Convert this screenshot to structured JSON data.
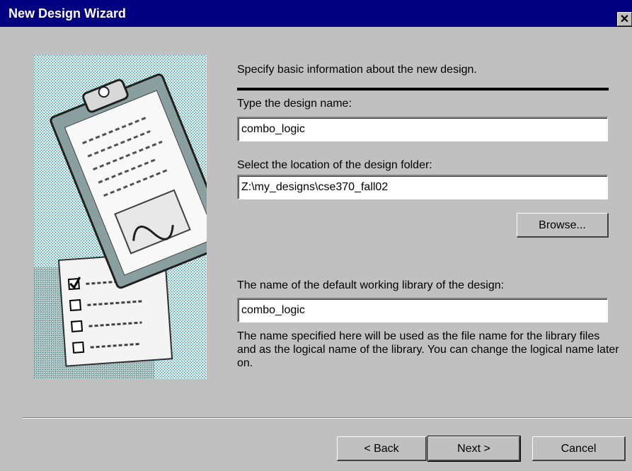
{
  "window": {
    "title": "New Design Wizard",
    "close_glyph": "✕"
  },
  "intro_text": "Specify basic information about the new design.",
  "design_name": {
    "label": "Type the design name:",
    "value": "combo_logic"
  },
  "design_folder": {
    "label": "Select the location of the design folder:",
    "value": "Z:\\my_designs\\cse370_fall02",
    "browse_label": "Browse..."
  },
  "library": {
    "label": "The name of the default working library of the design:",
    "value": "combo_logic",
    "help": "The name specified here will be used as the file name for the library files and as the logical name of the library. You can change the logical name later on."
  },
  "buttons": {
    "back": "< Back",
    "next": "Next >",
    "cancel": "Cancel"
  },
  "illustration": {
    "icon": "clipboard-checklist-icon",
    "accent_color": "#008080"
  }
}
